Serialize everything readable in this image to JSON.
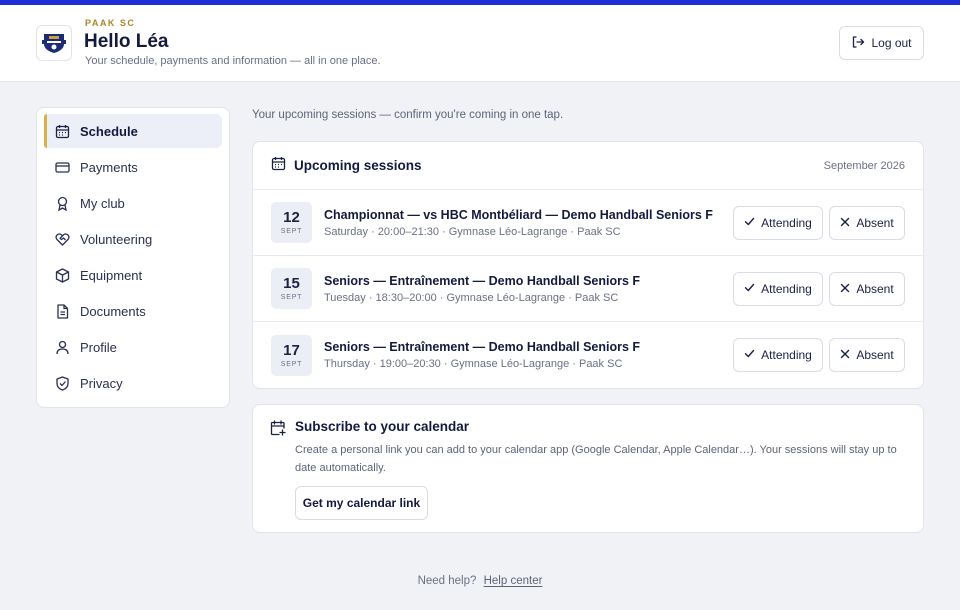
{
  "header": {
    "club_name": "PAAK SC",
    "greeting": "Hello Léa",
    "tagline": "Your schedule, payments and information — all in one place.",
    "logout_label": "Log out",
    "logo_icon": "club-crest-icon"
  },
  "sidebar": {
    "items": [
      {
        "label": "Schedule",
        "icon": "calendar-icon",
        "active": true
      },
      {
        "label": "Payments",
        "icon": "credit-card-icon"
      },
      {
        "label": "My club",
        "icon": "award-icon"
      },
      {
        "label": "Volunteering",
        "icon": "heart-handshake-icon"
      },
      {
        "label": "Equipment",
        "icon": "box-icon"
      },
      {
        "label": "Documents",
        "icon": "document-icon"
      },
      {
        "label": "Profile",
        "icon": "user-icon"
      },
      {
        "label": "Privacy",
        "icon": "shield-icon"
      }
    ]
  },
  "main": {
    "intro": "Your upcoming sessions — confirm you're coming in one tap.",
    "sessions": {
      "title": "Upcoming sessions",
      "month": "September 2026",
      "items": [
        {
          "day": "12",
          "month": "SEPT",
          "name": "Championnat — vs HBC Montbéliard — Demo Handball Seniors F",
          "meta": "Saturday · 20:00–21:30 · Gymnase Léo-Lagrange · Paak SC"
        },
        {
          "day": "15",
          "month": "SEPT",
          "name": "Seniors — Entraînement — Demo Handball Seniors F",
          "meta": "Tuesday · 18:30–20:00 · Gymnase Léo-Lagrange · Paak SC"
        },
        {
          "day": "17",
          "month": "SEPT",
          "name": "Seniors — Entraînement — Demo Handball Seniors F",
          "meta": "Thursday · 19:00–20:30 · Gymnase Léo-Lagrange · Paak SC"
        }
      ],
      "attending_label": "Attending",
      "absent_label": "Absent"
    },
    "subscribe": {
      "title": "Subscribe to your calendar",
      "description": "Create a personal link you can add to your calendar app (Google Calendar, Apple Calendar…). Your sessions will stay up to date automatically.",
      "button_label": "Get my calendar link"
    }
  },
  "footer": {
    "help_text": "Need help?",
    "help_link": "Help center"
  },
  "colors": {
    "accent": "#1f2dd6",
    "active_marker": "#d8b04a",
    "club_label": "#a8862a"
  }
}
